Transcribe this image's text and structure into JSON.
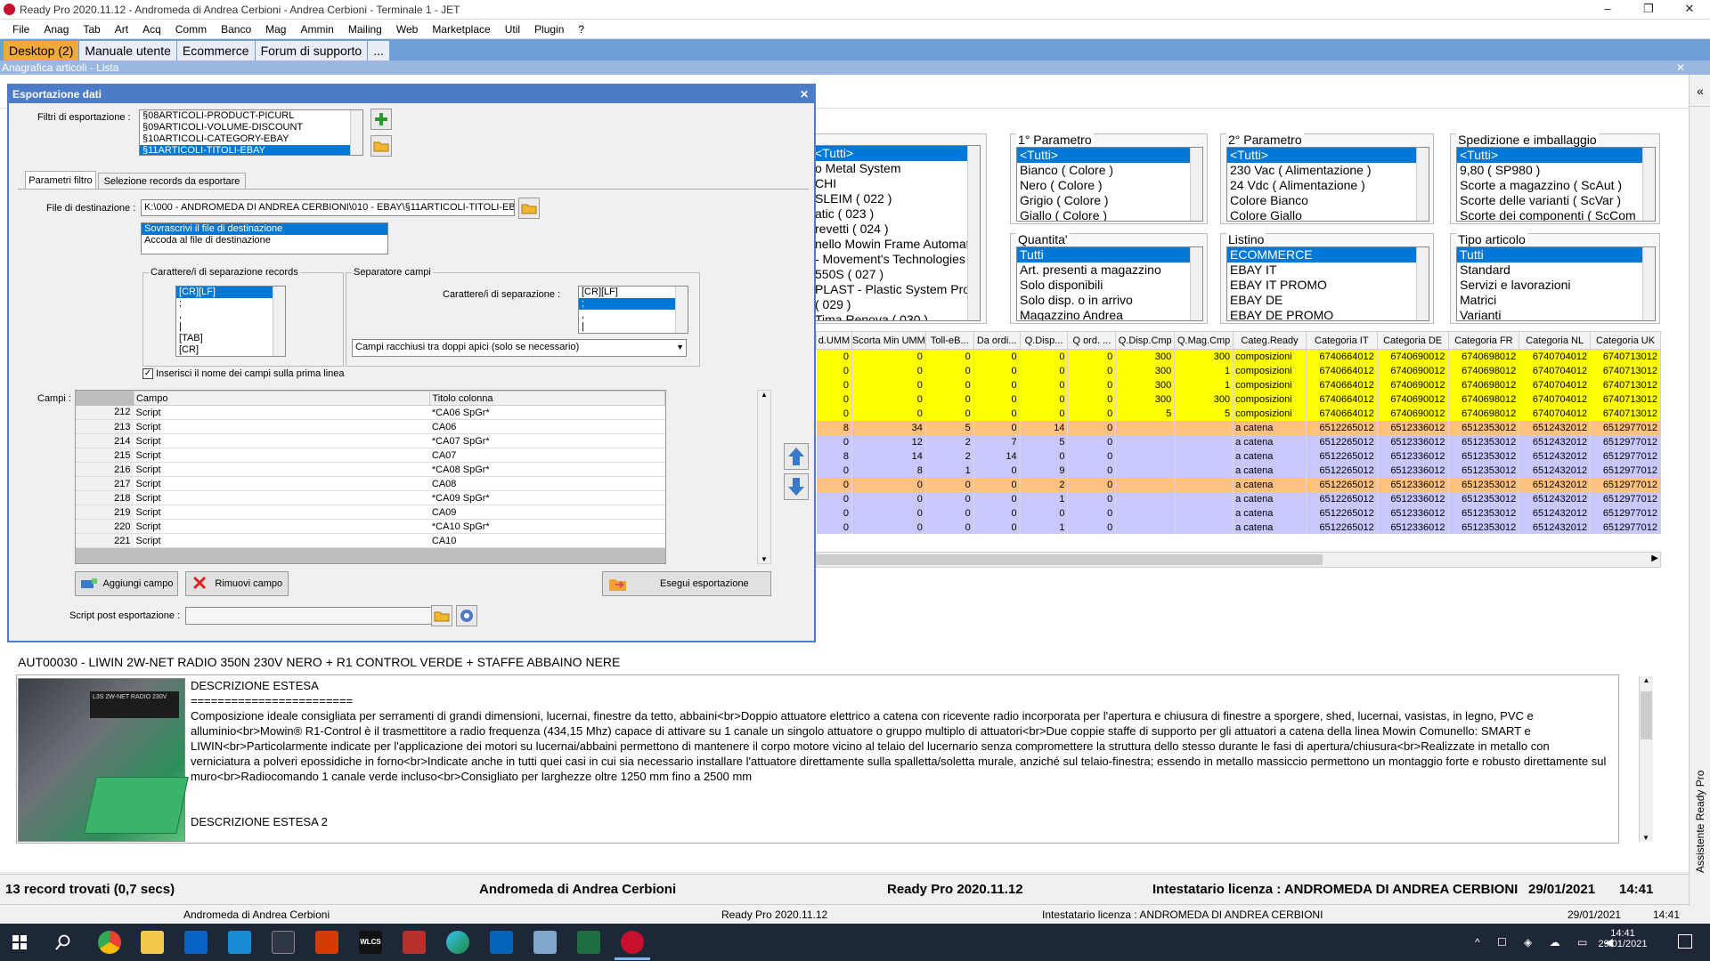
{
  "window": {
    "title": "Ready Pro 2020.11.12 - Andromeda di Andrea Cerbioni - Andrea Cerbioni - Terminale 1 - JET",
    "min": "–",
    "max": "❐",
    "close": "✕"
  },
  "menu": [
    "File",
    "Anag",
    "Tab",
    "Art",
    "Acq",
    "Comm",
    "Banco",
    "Mag",
    "Ammin",
    "Mailing",
    "Web",
    "Marketplace",
    "Util",
    "Plugin",
    "?"
  ],
  "tabs": [
    "Desktop (2)",
    "Manuale utente",
    "Ecommerce",
    "Forum di supporto",
    "..."
  ],
  "strip": "Anagrafica articoli  - Lista",
  "strip_close": "✕",
  "sidebar_toggle": "«",
  "sidebar_label": "Assistente Ready Pro",
  "filters": {
    "col0": {
      "items": [
        "<Tutti>",
        "o Metal System",
        "CHI",
        "SLEIM ( 022 )",
        "atic ( 023 )",
        "revetti ( 024 )",
        "nello Mowin Frame Automati",
        "- Movement's Technologies",
        "550S ( 027 )",
        "PLAST - Plastic System Produ",
        "( 029 )",
        "Tima Renova ( 030 )"
      ]
    },
    "p1": {
      "title": "1° Parametro",
      "items": [
        "<Tutti>",
        "Bianco ( Colore )",
        "Nero ( Colore )",
        "Grigio ( Colore )",
        "Giallo ( Colore )"
      ]
    },
    "p2": {
      "title": "2° Parametro",
      "items": [
        "<Tutti>",
        "230 Vac ( Alimentazione )",
        "24 Vdc ( Alimentazione )",
        "Colore Bianco",
        "Colore Giallo"
      ]
    },
    "sped": {
      "title": "Spedizione e imballaggio",
      "items": [
        "<Tutti>",
        "9,80 ( SP980 )",
        "Scorte a magazzino ( ScAut )",
        "Scorte delle varianti ( ScVar )",
        "Scorte dei componenti ( ScCom"
      ]
    },
    "qta": {
      "title": "Quantita'",
      "items": [
        "Tutti",
        "Art. presenti a magazzino",
        "Solo disponibili",
        "Solo disp. o in arrivo",
        "Magazzino Andrea"
      ]
    },
    "listino": {
      "title": "Listino",
      "items": [
        "ECOMMERCE",
        "EBAY IT",
        "EBAY IT PROMO",
        "EBAY DE",
        "EBAY DE PROMO"
      ]
    },
    "tipo": {
      "title": "Tipo articolo",
      "items": [
        "Tutti",
        "Standard",
        "Servizi e lavorazioni",
        "Matrici",
        "Varianti"
      ]
    }
  },
  "grid": {
    "columns": [
      "d.UMM",
      "Scorta Min UMM",
      "Toll-eB...",
      "Da ordi...",
      "Q.Disp...",
      "Q ord. ...",
      "Q.Disp.Cmp",
      "Q.Mag.Cmp",
      "Categ.Ready",
      "Categoria IT",
      "Categoria DE",
      "Categoria FR",
      "Categoria NL",
      "Categoria UK"
    ],
    "rows": [
      {
        "c": "#ffff00",
        "v": [
          "0",
          "0",
          "0",
          "0",
          "0",
          "0",
          "300",
          "300",
          "composizioni",
          "6740664012",
          "6740690012",
          "6740698012",
          "6740704012",
          "6740713012"
        ]
      },
      {
        "c": "#ffff00",
        "v": [
          "0",
          "0",
          "0",
          "0",
          "0",
          "0",
          "300",
          "1",
          "composizioni",
          "6740664012",
          "6740690012",
          "6740698012",
          "6740704012",
          "6740713012"
        ]
      },
      {
        "c": "#ffff00",
        "v": [
          "0",
          "0",
          "0",
          "0",
          "0",
          "0",
          "300",
          "1",
          "composizioni",
          "6740664012",
          "6740690012",
          "6740698012",
          "6740704012",
          "6740713012"
        ]
      },
      {
        "c": "#ffff00",
        "v": [
          "0",
          "0",
          "0",
          "0",
          "0",
          "0",
          "300",
          "300",
          "composizioni",
          "6740664012",
          "6740690012",
          "6740698012",
          "6740704012",
          "6740713012"
        ]
      },
      {
        "c": "#ffff00",
        "v": [
          "0",
          "0",
          "0",
          "0",
          "0",
          "0",
          "5",
          "5",
          "composizioni",
          "6740664012",
          "6740690012",
          "6740698012",
          "6740704012",
          "6740713012"
        ]
      },
      {
        "c": "#ffc080",
        "v": [
          "8",
          "34",
          "5",
          "0",
          "14",
          "0",
          "",
          "",
          "a catena",
          "6512265012",
          "6512336012",
          "6512353012",
          "6512432012",
          "6512977012"
        ]
      },
      {
        "c": "#c8c8ff",
        "v": [
          "0",
          "12",
          "2",
          "7",
          "5",
          "0",
          "",
          "",
          "a catena",
          "6512265012",
          "6512336012",
          "6512353012",
          "6512432012",
          "6512977012"
        ]
      },
      {
        "c": "#c8c8ff",
        "v": [
          "8",
          "14",
          "2",
          "14",
          "0",
          "0",
          "",
          "",
          "a catena",
          "6512265012",
          "6512336012",
          "6512353012",
          "6512432012",
          "6512977012"
        ]
      },
      {
        "c": "#c8c8ff",
        "v": [
          "0",
          "8",
          "1",
          "0",
          "9",
          "0",
          "",
          "",
          "a catena",
          "6512265012",
          "6512336012",
          "6512353012",
          "6512432012",
          "6512977012"
        ]
      },
      {
        "c": "#ffc080",
        "v": [
          "0",
          "0",
          "0",
          "0",
          "2",
          "0",
          "",
          "",
          "a catena",
          "6512265012",
          "6512336012",
          "6512353012",
          "6512432012",
          "6512977012"
        ]
      },
      {
        "c": "#c8c8ff",
        "v": [
          "0",
          "0",
          "0",
          "0",
          "1",
          "0",
          "",
          "",
          "a catena",
          "6512265012",
          "6512336012",
          "6512353012",
          "6512432012",
          "6512977012"
        ]
      },
      {
        "c": "#c8c8ff",
        "v": [
          "0",
          "0",
          "0",
          "0",
          "0",
          "0",
          "",
          "",
          "a catena",
          "6512265012",
          "6512336012",
          "6512353012",
          "6512432012",
          "6512977012"
        ]
      },
      {
        "c": "#c8c8ff",
        "v": [
          "0",
          "0",
          "0",
          "0",
          "1",
          "0",
          "",
          "",
          "a catena",
          "6512265012",
          "6512336012",
          "6512353012",
          "6512432012",
          "6512977012"
        ]
      }
    ]
  },
  "dialog": {
    "title": "Esportazione dati",
    "close": "✕",
    "filtri_label": "Filtri di esportazione :",
    "filtri": [
      "§08ARTICOLI-PRODUCT-PICURL",
      "§09ARTICOLI-VOLUME-DISCOUNT",
      "§10ARTICOLI-CATEGORY-EBAY",
      "§11ARTICOLI-TITOLI-EBAY"
    ],
    "tab1": "Parametri filtro",
    "tab2": "Selezione records da esportare",
    "dest_label": "File di destinazione :",
    "dest_value": "K:\\000 - ANDROMEDA DI ANDREA CERBIONI\\010 - EBAY\\§11ARTICOLI-TITOLI-EBAY",
    "dest_opts": [
      "Sovrascrivi il file di destinazione",
      "Accoda al file di destinazione"
    ],
    "rec_sep_title": "Carattere/i di separazione records",
    "rec_sep": [
      "[CR][LF]",
      ";",
      ",",
      "|",
      "[TAB]",
      "[CR]"
    ],
    "field_sep_title": "Separatore campi",
    "field_sep_label": "Carattere/i di separazione :",
    "field_sep": [
      "[CR][LF]",
      ";",
      ",",
      "|"
    ],
    "quote_opt": "Campi racchiusi tra doppi apici (solo se necessario)",
    "header_chk": "Inserisci il nome dei campi sulla prima linea",
    "campi_label": "Campi :",
    "campi_cols": [
      "Campo",
      "Titolo colonna"
    ],
    "campi_rows": [
      [
        "212",
        "Script",
        "*CA06 SpGr*"
      ],
      [
        "213",
        "Script",
        "CA06"
      ],
      [
        "214",
        "Script",
        "*CA07 SpGr*"
      ],
      [
        "215",
        "Script",
        "CA07"
      ],
      [
        "216",
        "Script",
        "*CA08 SpGr*"
      ],
      [
        "217",
        "Script",
        "CA08"
      ],
      [
        "218",
        "Script",
        "*CA09 SpGr*"
      ],
      [
        "219",
        "Script",
        "CA09"
      ],
      [
        "220",
        "Script",
        "*CA10 SpGr*"
      ],
      [
        "221",
        "Script",
        "CA10"
      ]
    ],
    "btn_add": "Aggiungi campo",
    "btn_remove": "Rimuovi campo",
    "btn_exec": "Esegui esportazione",
    "post_label": "Script post esportazione :",
    "post_value": ""
  },
  "product": {
    "title": "AUT00030 - LIWIN 2W-NET RADIO 350N 230V NERO + R1 CONTROL VERDE + STAFFE ABBAINO NERE",
    "image_text": "L3S 2W-NET RADIO 230V",
    "desc_head": "DESCRIZIONE ESTESA",
    "desc_rule": "========================",
    "desc_body": "Composizione ideale consigliata per serramenti di grandi dimensioni, lucernai, finestre da tetto, abbaini<br>Doppio attuatore elettrico a catena con ricevente radio incorporata per l'apertura e chiusura di finestre a sporgere, shed, lucernai, vasistas, in legno, PVC e alluminio<br>Mowin® R1-Control è il trasmettitore a radio frequenza (434,15 Mhz) capace di attivare su 1 canale un singolo attuatore o gruppo multiplo di attuatori<br>Due coppie staffe di supporto per gli attuatori a catena della linea Mowin Comunello: SMART e LIWIN<br>Particolarmente indicate per l'applicazione dei motori su lucernai/abbaini permettono di mantenere il corpo motore vicino al telaio del lucernario senza compromettere la struttura dello stesso durante le fasi di apertura/chiusura<br>Realizzate in metallo con verniciatura a polveri epossidiche in forno<br>Indicate anche in tutti quei casi in cui sia necessario installare l'attuatore direttamente sulla spalletta/soletta murale, anziché sul telaio-finestra; essendo in metallo massiccio permettono un montaggio forte e robusto direttamente sul muro<br>Radiocomando 1 canale verde incluso<br>Consigliato per larghezze oltre 1250 mm fino a 2500 mm",
    "desc2": "DESCRIZIONE ESTESA 2"
  },
  "status": {
    "records": "13 record trovati (0,7 secs)",
    "company": "Andromeda di Andrea Cerbioni",
    "version": "Ready Pro 2020.11.12",
    "license": "Intestatario licenza : ANDROMEDA DI ANDREA CERBIONI",
    "date": "29/01/2021",
    "time": "14:41"
  },
  "status2": {
    "company": "Andromeda di Andrea Cerbioni",
    "version": "Ready Pro 2020.11.12",
    "license": "Intestatario licenza : ANDROMEDA DI ANDREA CERBIONI",
    "date": "29/01/2021",
    "time": "14:41"
  },
  "taskbar": {
    "time": "14:41",
    "date": "29/01/2021",
    "wlcs": "WLCS"
  }
}
